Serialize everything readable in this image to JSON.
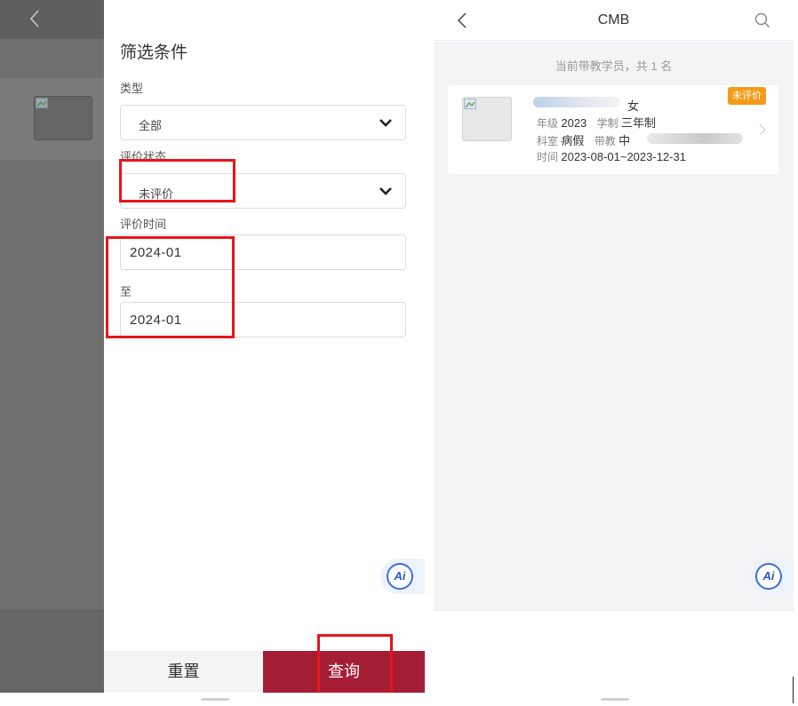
{
  "left": {
    "drawer": {
      "title": "筛选条件",
      "type_label": "类型",
      "type_value": "全部",
      "status_label": "评价状态",
      "status_value": "未评价",
      "time_label": "评价时间",
      "time_start": "2024-01",
      "to_label": "至",
      "time_end": "2024-01"
    },
    "buttons": {
      "reset": "重置",
      "query": "查询"
    },
    "ai_label": "Ai"
  },
  "right": {
    "header": {
      "title": "CMB"
    },
    "count_text": "当前带教学员，共 1 名",
    "card": {
      "gender": "女",
      "badge": "未评价",
      "grade_label": "年级",
      "grade_value": "2023",
      "system_label": "学制",
      "system_value": "三年制",
      "dept_label": "科室",
      "dept_value": "病假",
      "teacher_label": "带教",
      "teacher_value": "中",
      "time_label": "时间",
      "time_value": "2023-08-01~2023-12-31"
    },
    "ai_label": "Ai"
  },
  "colors": {
    "accent": "#a51d35",
    "badge": "#f39b1a",
    "highlight": "#e8141b",
    "ai_blue": "#3e6fd8"
  },
  "icons": {
    "back": "chevron-left-icon",
    "search": "search-icon",
    "dropdown": "chevron-down-icon",
    "card_arrow": "chevron-right-icon",
    "broken_image": "broken-image-icon"
  }
}
